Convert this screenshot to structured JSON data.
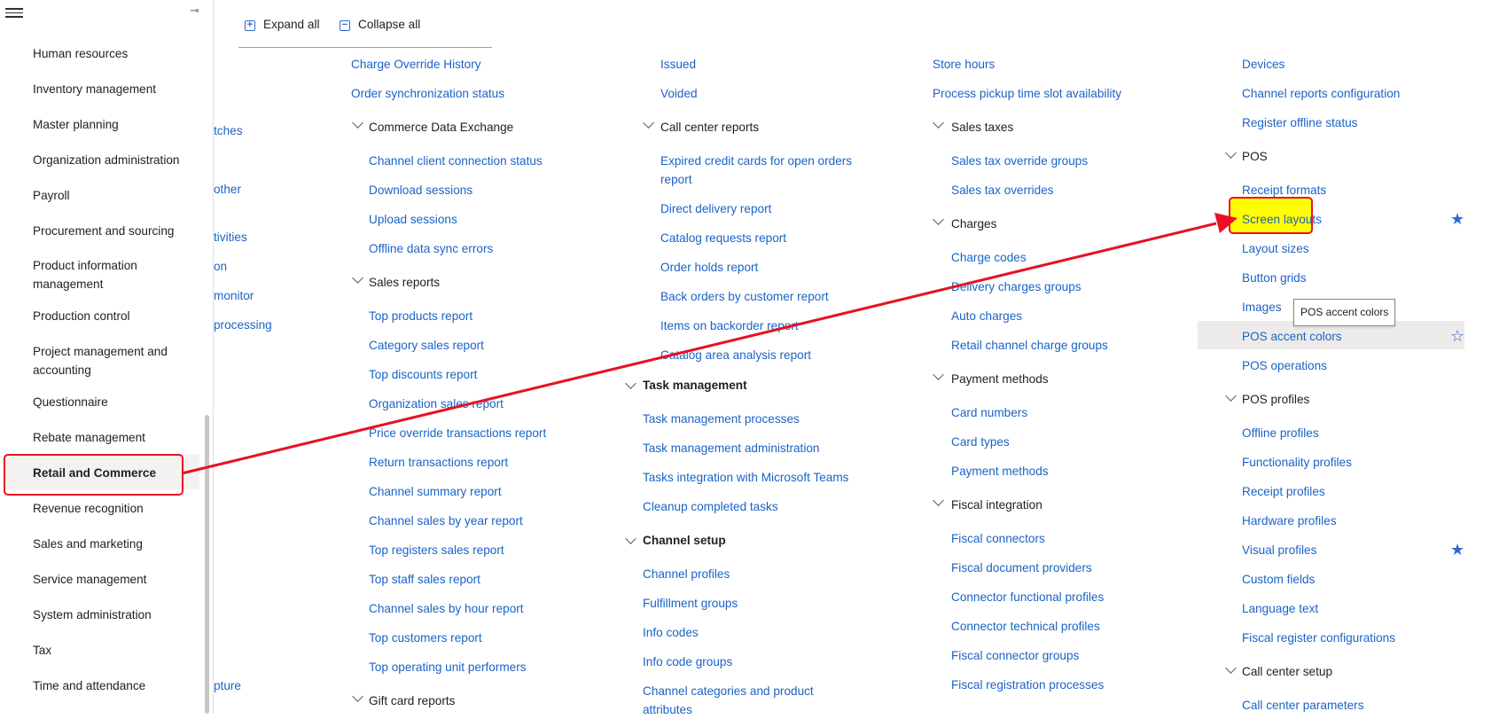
{
  "toolbar": {
    "expand_all": "Expand all",
    "collapse_all": "Collapse all"
  },
  "nav": {
    "items": [
      "Human resources",
      "Inventory management",
      "Master planning",
      "Organization administration",
      "Payroll",
      "Procurement and sourcing",
      "Product information management",
      "Production control",
      "Project management and accounting",
      "Questionnaire",
      "Rebate management",
      "Retail and Commerce",
      "Revenue recognition",
      "Sales and marketing",
      "Service management",
      "System administration",
      "Tax",
      "Time and attendance"
    ],
    "selected": "Retail and Commerce"
  },
  "col0": {
    "items": [
      "tches",
      "other",
      "tivities",
      "on",
      "monitor",
      "processing",
      "pture"
    ]
  },
  "col1": {
    "charge_override_history": "Charge Override History",
    "order_sync_status": "Order synchronization status",
    "cde_header": "Commerce Data Exchange",
    "cde_items": [
      "Channel client connection status",
      "Download sessions",
      "Upload sessions",
      "Offline data sync errors"
    ],
    "sales_reports_header": "Sales reports",
    "sales_reports_items": [
      "Top products report",
      "Category sales report",
      "Top discounts report",
      "Organization sales report",
      "Price override transactions report",
      "Return transactions report",
      "Channel summary report",
      "Channel sales by year report",
      "Top registers sales report",
      "Top staff sales report",
      "Channel sales by hour report",
      "Top customers report",
      "Top operating unit performers"
    ],
    "gift_card_header": "Gift card reports"
  },
  "col2": {
    "issued": "Issued",
    "voided": "Voided",
    "call_center_header": "Call center reports",
    "call_center_items": [
      "Expired credit cards for open orders report",
      "Direct delivery report",
      "Catalog requests report",
      "Order holds report",
      "Back orders by customer report",
      "Items on backorder report",
      "Catalog area analysis report"
    ],
    "task_mgmt_header": "Task management",
    "task_mgmt_items": [
      "Task management processes",
      "Task management administration",
      "Tasks integration with Microsoft Teams",
      "Cleanup completed tasks"
    ],
    "channel_setup_header": "Channel setup",
    "channel_setup_items": [
      "Channel profiles",
      "Fulfillment groups",
      "Info codes",
      "Info code groups",
      "Channel categories and product attributes"
    ]
  },
  "col3": {
    "store_hours": "Store hours",
    "pickup_slot": "Process pickup time slot availability",
    "sales_taxes_header": "Sales taxes",
    "sales_taxes_items": [
      "Sales tax override groups",
      "Sales tax overrides"
    ],
    "charges_header": "Charges",
    "charges_items": [
      "Charge codes",
      "Delivery charges groups",
      "Auto charges",
      "Retail channel charge groups"
    ],
    "payment_header": "Payment methods",
    "payment_items": [
      "Card numbers",
      "Card types",
      "Payment methods"
    ],
    "fiscal_header": "Fiscal integration",
    "fiscal_items": [
      "Fiscal connectors",
      "Fiscal document providers",
      "Connector functional profiles",
      "Connector technical profiles",
      "Fiscal connector groups",
      "Fiscal registration processes"
    ]
  },
  "col4": {
    "devices": "Devices",
    "channel_reports_config": "Channel reports configuration",
    "register_offline_status": "Register offline status",
    "pos_header": "POS",
    "pos_items": [
      "Receipt formats",
      "Screen layouts",
      "Layout sizes",
      "Button grids",
      "Images",
      "POS accent colors",
      "POS operations"
    ],
    "pos_profiles_header": "POS profiles",
    "pos_profiles_items": [
      "Offline profiles",
      "Functionality profiles",
      "Receipt profiles",
      "Hardware profiles",
      "Visual profiles",
      "Custom fields",
      "Language text",
      "Fiscal register configurations"
    ],
    "call_center_setup_header": "Call center setup",
    "call_center_params": "Call center parameters"
  },
  "tooltip": "POS accent colors",
  "colors": {
    "link": "#1a63c7",
    "highlight_fill": "#ffff00",
    "annotation_red": "#e81123",
    "star": "#2f6bd1"
  }
}
